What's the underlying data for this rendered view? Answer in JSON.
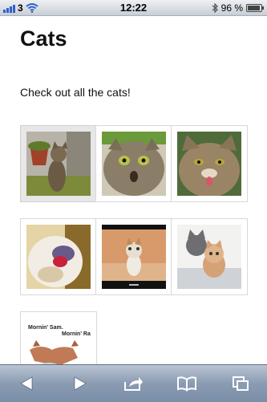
{
  "status_bar": {
    "carrier": "3",
    "time": "12:22",
    "battery": "96 %",
    "battery_level": 0.96,
    "signal_bars": 4
  },
  "page": {
    "title": "Cats",
    "intro": "Check out all the cats!"
  },
  "gallery": {
    "thumb_captions": [
      "Mornin' Sam.",
      "Mornin' Ra"
    ]
  },
  "toolbar": {
    "items": [
      "back-icon",
      "forward-icon",
      "share-icon",
      "bookmarks-icon",
      "tabs-icon"
    ]
  },
  "colors": {
    "toolbar": "#8a9bb2",
    "signal": "#2b64c8"
  }
}
